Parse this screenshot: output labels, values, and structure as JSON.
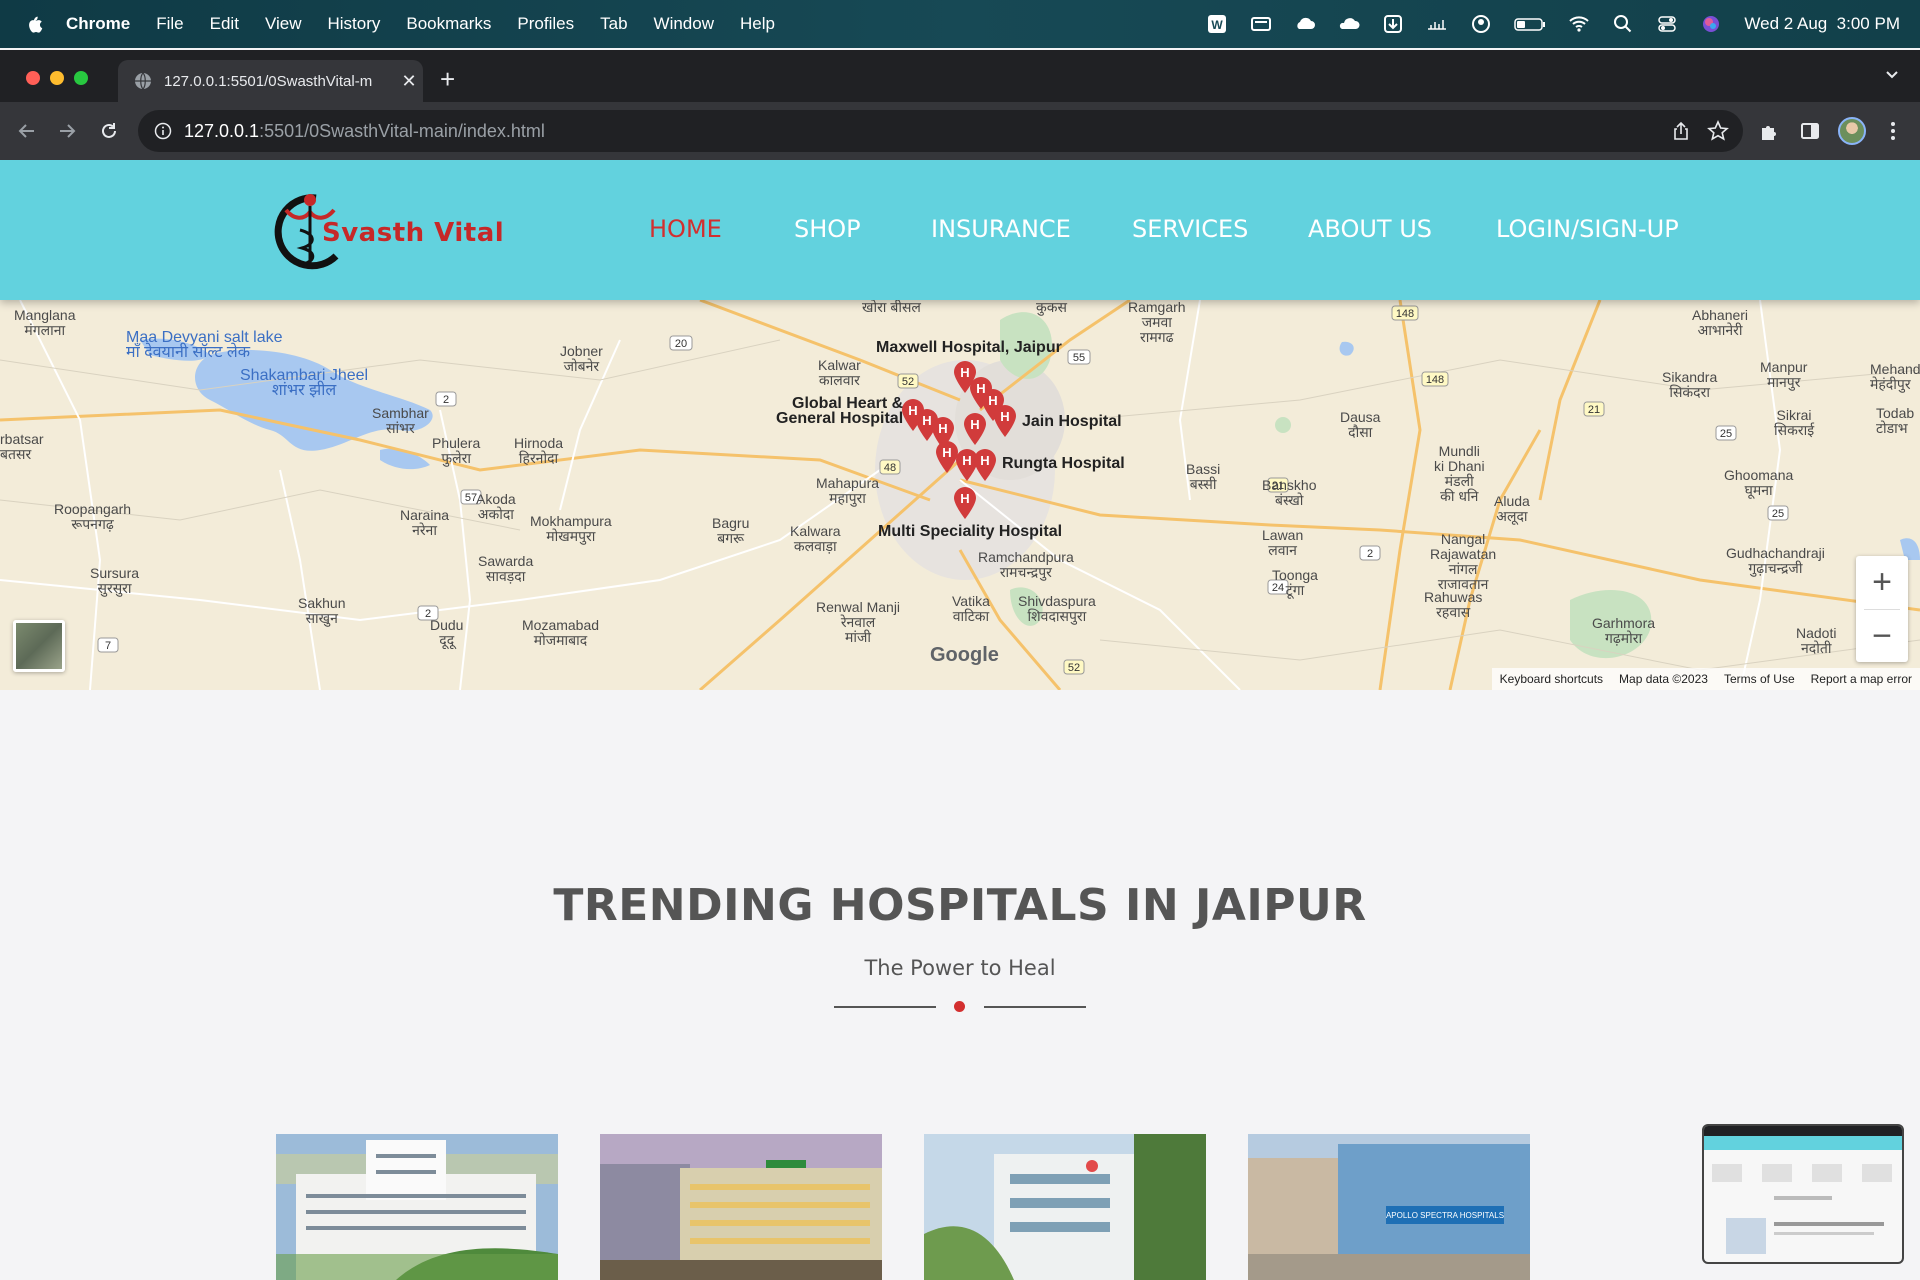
{
  "menubar": {
    "app": "Chrome",
    "items": [
      "File",
      "Edit",
      "View",
      "History",
      "Bookmarks",
      "Profiles",
      "Tab",
      "Window",
      "Help"
    ],
    "clock": "Wed 2 Aug  3:00 PM"
  },
  "browser": {
    "tab_title": "127.0.0.1:5501/0SwasthVital-m",
    "url_host": "127.0.0.1",
    "url_path": ":5501/0SwasthVital-main/index.html"
  },
  "site": {
    "logo_text": "Svasth Vital",
    "nav": [
      "HOME",
      "SHOP",
      "INSURANCE",
      "SERVICES",
      "ABOUT US",
      "LOGIN/SIGN-UP"
    ],
    "active_nav": "HOME",
    "accent_color": "#d32f2f",
    "header_color": "#62d2de"
  },
  "map": {
    "labels": {
      "manglana": "Manglana\nमंगलाना",
      "maa_devyani": "Maa Devyani salt lake\nमाँ देवयानी सॉल्ट लेक",
      "shakambari": "Shakambari Jheel\nशांभर झील",
      "sambhar": "Sambhar\nसांभर",
      "jobner": "Jobner\nजोबनेर",
      "phulera": "Phulera\nफुलेरा",
      "hirnoda": "Hirnoda\nहिरनोदा",
      "akoda": "Akoda\nअकोदा",
      "naraina": "Naraina\nनरेना",
      "roopangarh": "Roopangarh\nरूपनगढ़",
      "mokhampura": "Mokhampura\nमोखमपुरा",
      "sawarda": "Sawarda\nसावड़दा",
      "sursura": "Sursura\nसुरसुरा",
      "sakhun": "Sakhun\nसाखुन",
      "dudu": "Dudu\nदूदू",
      "mozamabad": "Mozamabad\nमोजमाबाद",
      "rbatsar": "rbatsar\nबतसर",
      "khora_bisal": "खोरा बीसल",
      "kalwar": "Kalwar\nकालवार",
      "maxwell": "Maxwell Hospital, Jaipur",
      "global_heart": "Global Heart &\nGeneral Hospital",
      "jain": "Jain Hospital",
      "rungta": "Rungta Hospital",
      "mahapura": "Mahapura\nमहापुरा",
      "bagru": "Bagru\nबगरू",
      "kalwara": "Kalwara\nकलवाड़ा",
      "multi": "Multi Speciality Hospital",
      "ramchandpura": "Ramchandpura\nरामचन्द्रपुर",
      "renwal": "Renwal Manji\nरेनवाल\nमांजी",
      "vatika": "Vatika\nवाटिका",
      "shivdaspura": "Shivdaspura\nशिवदासपुरा",
      "ramgarh": "Ramgarh\nजमवा\nरामगढ",
      "kukas": "कुकस",
      "bassi": "Bassi\nबस्सी",
      "banskho": "Banskho\nबंस्खो",
      "lawan": "Lawan\nलवान",
      "toonga": "Toonga\nटूंगा",
      "dausa": "Dausa\nदौसा",
      "mundli": "Mundli\nki Dhani\nमंडली\nकी धनि",
      "aluda": "Aluda\nअलूदा",
      "nangal": "Nangal\nRajawatan\nनांगल\nराजावतान",
      "rahuwas": "Rahuwas\nरहवास",
      "abhaneri": "Abhaneri\nआभानेरी",
      "sikandra": "Sikandra\nसिकंदरा",
      "manpur": "Manpur\nमानपुर",
      "sikrai": "Sikrai\nसिकराई",
      "mehandipur": "Mehandip\nमेहंदीपुर",
      "todab": "Todab\nटोडाभ",
      "ghoomana": "Ghoomana\nघूमना",
      "gudhachandraji": "Gudhachandraji\nगुढ़ाचन्द्रजी",
      "garhmora": "Garhmora\nगढ़मोरा",
      "nadoti": "Nadoti\nनदोती"
    },
    "route_shields": [
      "52",
      "20",
      "55",
      "48",
      "148",
      "2",
      "57",
      "21",
      "25",
      "24",
      "7",
      "2",
      "2"
    ],
    "google_logo": "Google",
    "footer": [
      "Keyboard shortcuts",
      "Map data ©2023",
      "Terms of Use",
      "Report a map error"
    ]
  },
  "trending": {
    "title": "TRENDING HOSPITALS IN JAIPUR",
    "subtitle": "The Power to Heal",
    "card_4_sign": "APOLLO SPECTRA HOSPITALS"
  }
}
